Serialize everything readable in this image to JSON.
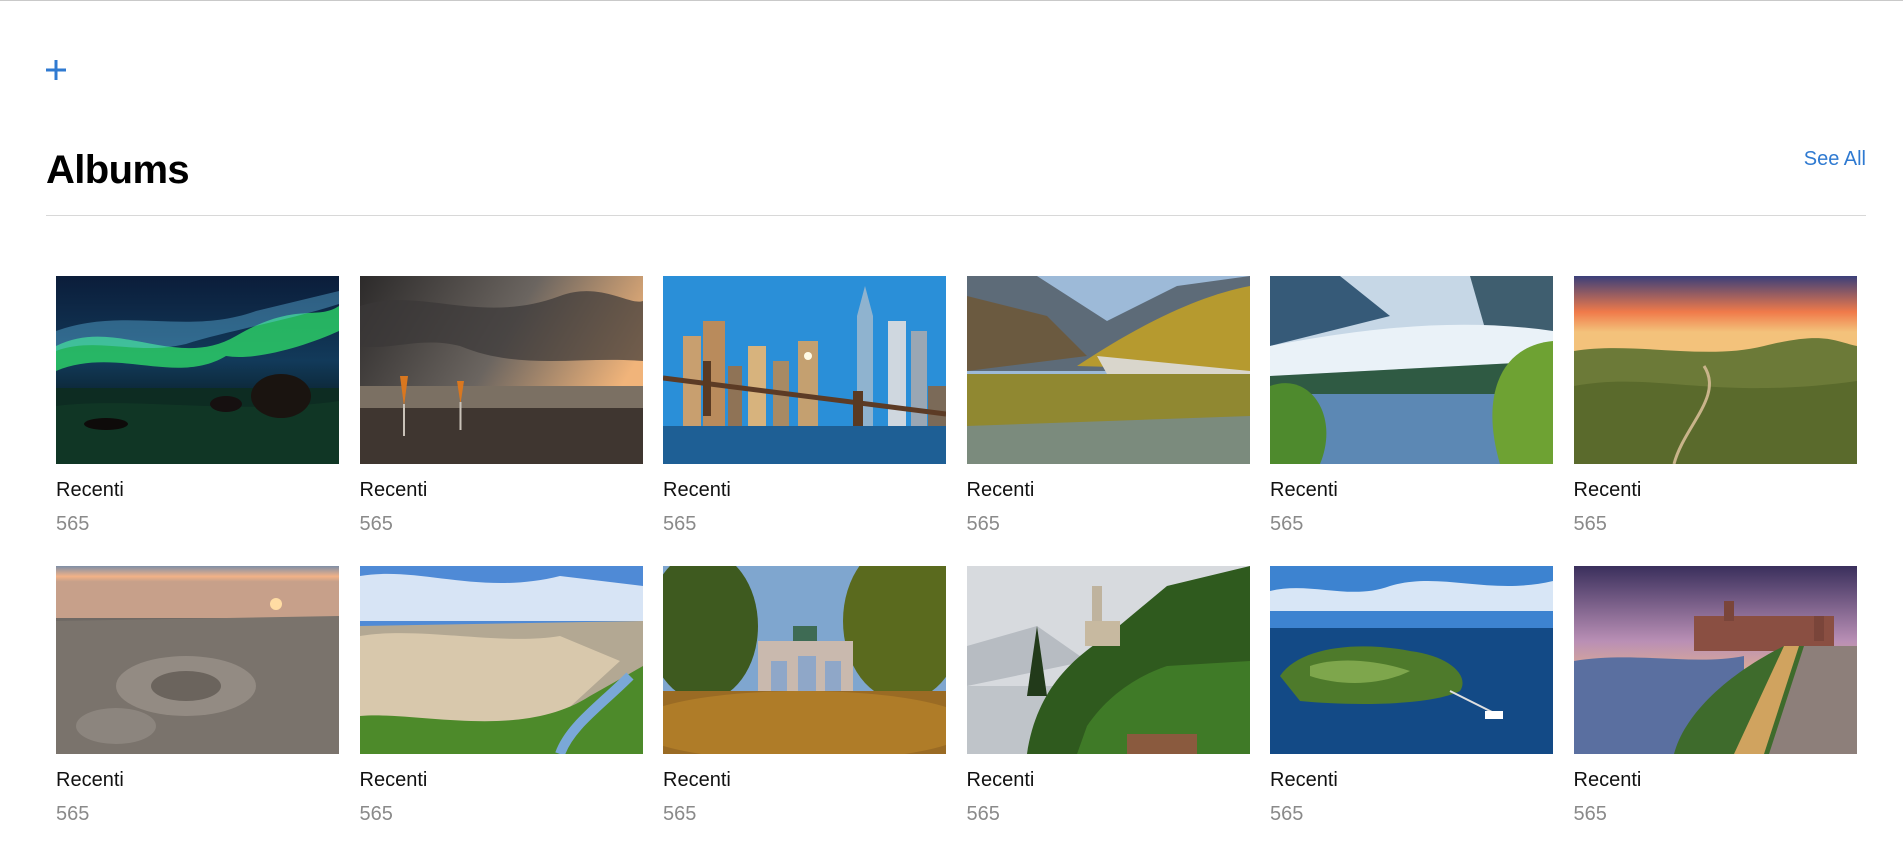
{
  "header": {
    "title": "Albums",
    "see_all_label": "See All"
  },
  "icons": {
    "add": "plus-icon"
  },
  "colors": {
    "accent": "#2f7ad1",
    "count_text": "#8a8a8a"
  },
  "albums": [
    {
      "title": "Recenti",
      "count": "565",
      "scene": "aurora over rocky shore"
    },
    {
      "title": "Recenti",
      "count": "565",
      "scene": "storm clouds over beach with umbrellas"
    },
    {
      "title": "Recenti",
      "count": "565",
      "scene": "city skyline with bridge"
    },
    {
      "title": "Recenti",
      "count": "565",
      "scene": "autumn mountain lake reflection"
    },
    {
      "title": "Recenti",
      "count": "565",
      "scene": "glacier and lake"
    },
    {
      "title": "Recenti",
      "count": "565",
      "scene": "rolling hills at sunset"
    },
    {
      "title": "Recenti",
      "count": "565",
      "scene": "rocky plateau at sunrise"
    },
    {
      "title": "Recenti",
      "count": "565",
      "scene": "hilltop town above river"
    },
    {
      "title": "Recenti",
      "count": "565",
      "scene": "triumphal arch between trees"
    },
    {
      "title": "Recenti",
      "count": "565",
      "scene": "villa on lakeside cliff"
    },
    {
      "title": "Recenti",
      "count": "565",
      "scene": "island in blue lake"
    },
    {
      "title": "Recenti",
      "count": "565",
      "scene": "riverside town at dusk"
    }
  ]
}
